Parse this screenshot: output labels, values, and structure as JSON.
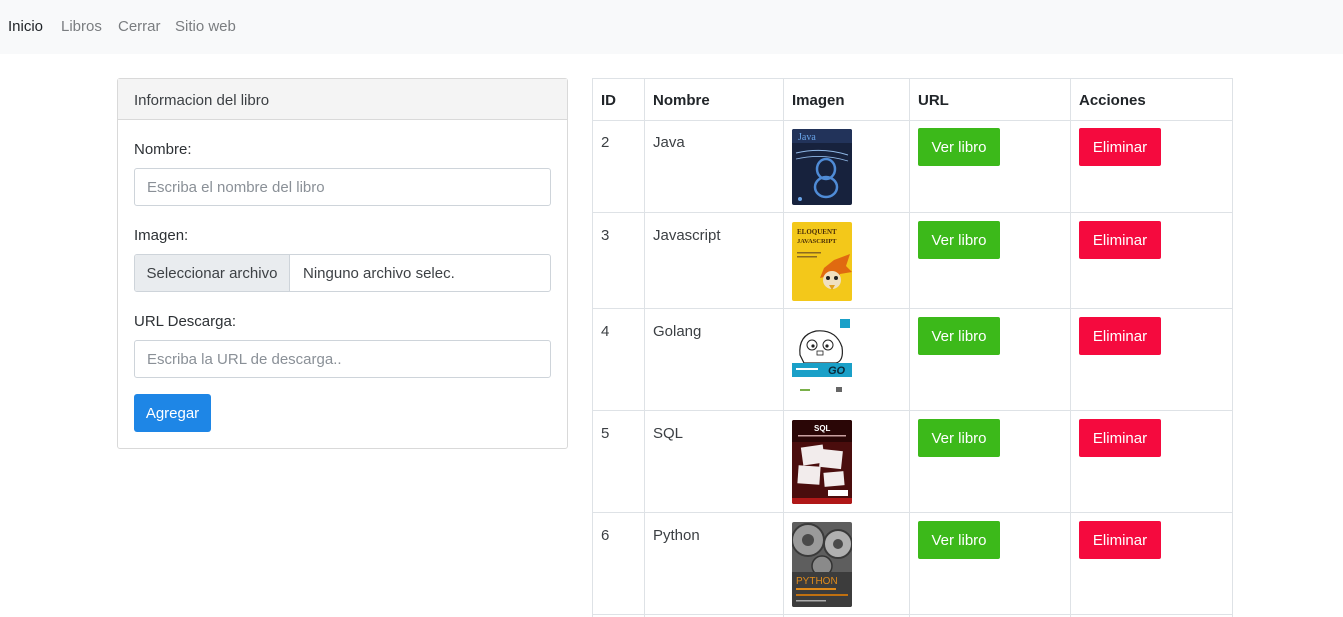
{
  "nav": {
    "items": [
      "Inicio",
      "Libros",
      "Cerrar",
      "Sitio web"
    ]
  },
  "form": {
    "title": "Informacion del libro",
    "name_label": "Nombre:",
    "name_placeholder": "Escriba el nombre del libro",
    "image_label": "Imagen:",
    "file_button": "Seleccionar archivo",
    "file_status": "Ninguno archivo selec.",
    "url_label": "URL Descarga:",
    "url_placeholder": "Escriba la URL de descarga..",
    "submit": "Agregar"
  },
  "table": {
    "headers": [
      "ID",
      "Nombre",
      "Imagen",
      "URL",
      "Acciones"
    ],
    "view_label": "Ver libro",
    "delete_label": "Eliminar",
    "rows": [
      {
        "id": "2",
        "name": "Java",
        "cover": {
          "title": "Java",
          "icon": "java-book-cover",
          "bg": "#16203a",
          "fg": "#4f8bd6"
        }
      },
      {
        "id": "3",
        "name": "Javascript",
        "cover": {
          "title": "ELOQUENT JAVASCRIPT",
          "icon": "javascript-book-cover",
          "bg": "#f3c81a",
          "fg": "#5a3a10"
        }
      },
      {
        "id": "4",
        "name": "Golang",
        "cover": {
          "title": "GO",
          "icon": "golang-book-cover",
          "bg": "#ffffff",
          "fg": "#1aa0c8"
        }
      },
      {
        "id": "5",
        "name": "SQL",
        "cover": {
          "title": "SQL",
          "icon": "sql-book-cover",
          "bg": "#4a0d0d",
          "fg": "#ffffff"
        }
      },
      {
        "id": "6",
        "name": "Python",
        "cover": {
          "title": "PYTHON",
          "icon": "python-book-cover",
          "bg": "#5a5a5a",
          "fg": "#e08a1a"
        }
      }
    ]
  },
  "colors": {
    "primary": "#1e86e6",
    "success": "#3cb91a",
    "danger": "#f50a3e",
    "navbar_bg": "#f8f9fa"
  }
}
